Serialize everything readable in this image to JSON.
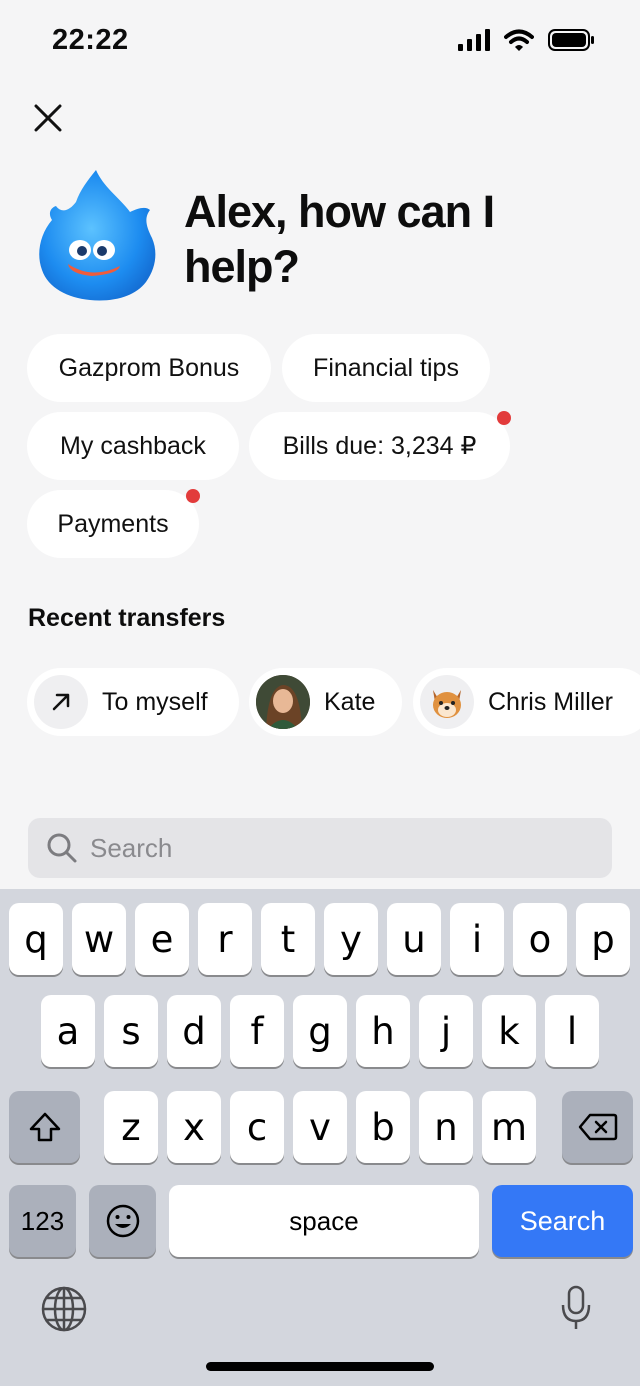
{
  "status_bar": {
    "time": "22:22"
  },
  "header": {
    "greeting": "Alex, how can I help?"
  },
  "chips": {
    "gazprom_bonus": "Gazprom Bonus",
    "financial_tips": "Financial tips",
    "my_cashback": "My cashback",
    "bills_due": "Bills due: 3,234 ₽",
    "payments": "Payments"
  },
  "recent_transfers": {
    "title": "Recent transfers",
    "items": [
      {
        "label": "To myself",
        "icon": "arrow-up-right-icon"
      },
      {
        "label": "Kate",
        "icon": "avatar-photo"
      },
      {
        "label": "Chris Miller",
        "icon": "dog-emoji-avatar"
      }
    ]
  },
  "search": {
    "placeholder": "Search"
  },
  "keyboard": {
    "row1": [
      "q",
      "w",
      "e",
      "r",
      "t",
      "y",
      "u",
      "i",
      "o",
      "p"
    ],
    "row2": [
      "a",
      "s",
      "d",
      "f",
      "g",
      "h",
      "j",
      "k",
      "l"
    ],
    "row3": [
      "z",
      "x",
      "c",
      "v",
      "b",
      "n",
      "m"
    ],
    "numbers_label": "123",
    "space_label": "space",
    "search_label": "Search"
  },
  "colors": {
    "accent": "#3478f6",
    "notification_dot": "#e23b3b",
    "background": "#f5f5f6"
  }
}
